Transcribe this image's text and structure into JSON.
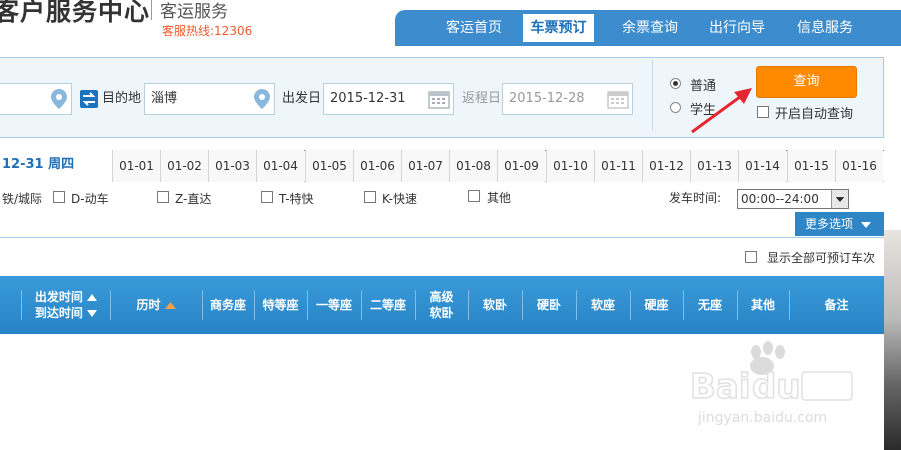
{
  "header": {
    "logo_text": "客户服务中心",
    "logo_sub": "客运服务",
    "hotline": "客服热线:12306",
    "nav": [
      "客运首页",
      "车票预订",
      "余票查询",
      "出行向导",
      "信息服务"
    ],
    "active_nav": "车票预订"
  },
  "search": {
    "to_label": "目的地",
    "to_value": "淄博",
    "depart_label": "出发日",
    "depart_value": "2015-12-31",
    "return_label": "返程日",
    "return_value": "2015-12-28",
    "ticket_types": [
      "普通",
      "学生"
    ],
    "selected_type": "普通",
    "query_label": "查询",
    "auto_query_label": "开启自动查询"
  },
  "dates": {
    "current": "12-31 周四",
    "tabs": [
      "01-01",
      "01-02",
      "01-03",
      "01-04",
      "01-05",
      "01-06",
      "01-07",
      "01-08",
      "01-09",
      "01-10",
      "01-11",
      "01-12",
      "01-13",
      "01-14",
      "01-15",
      "01-16"
    ]
  },
  "filters": {
    "partial_label": "铁/城际",
    "types": [
      "D-动车",
      "Z-直达",
      "T-特快",
      "K-快速",
      "其他"
    ],
    "time_label": "发车时间:",
    "time_value": "00:00--24:00",
    "more_label": "更多选项",
    "show_all_label": "显示全部可预订车次"
  },
  "table": {
    "depart_time": "出发时间",
    "arrive_time": "到达时间",
    "duration": "历时",
    "columns": [
      "商务座",
      "特等座",
      "一等座",
      "二等座",
      "高级软卧",
      "软卧",
      "硬卧",
      "软座",
      "硬座",
      "无座",
      "其他",
      "备注"
    ]
  },
  "colors": {
    "brand_blue": "#3d8ccd",
    "accent_orange": "#ff8a00",
    "hotline_red": "#f05a28"
  }
}
